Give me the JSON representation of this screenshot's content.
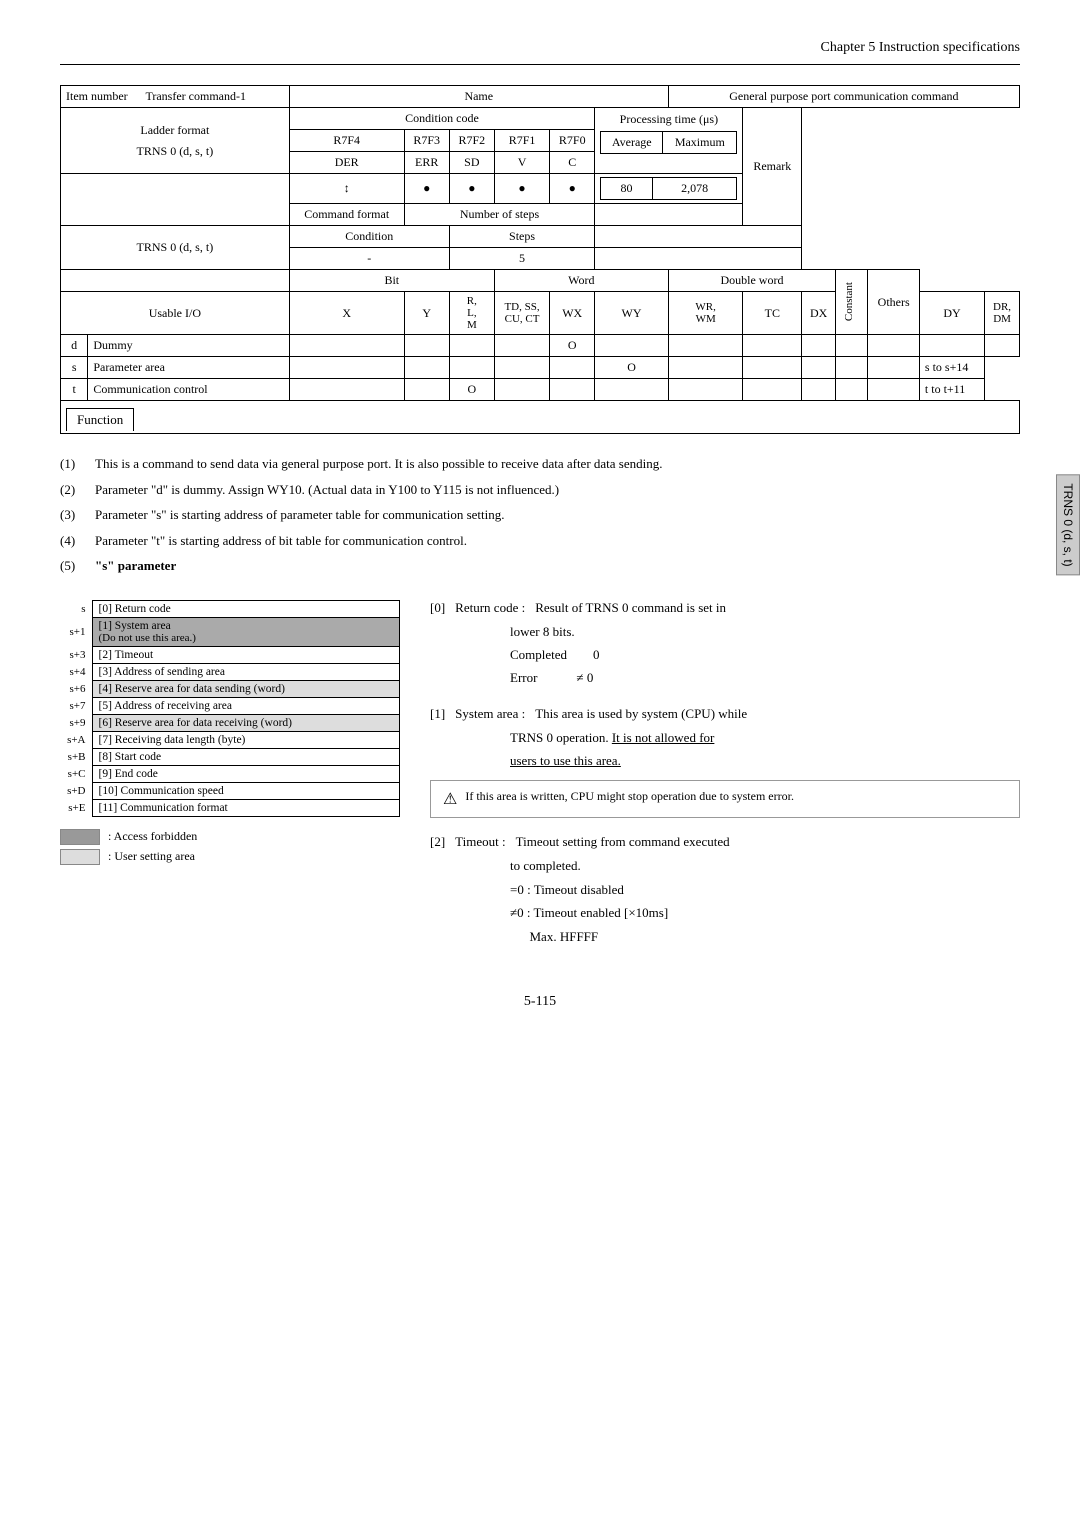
{
  "chapter": {
    "title": "Chapter 5   Instruction specifications"
  },
  "table": {
    "item_number_label": "Item number",
    "transfer_command_label": "Transfer command-1",
    "name_label": "Name",
    "name_value": "General purpose port communication command",
    "ladder_format_label": "Ladder format",
    "condition_code_label": "Condition code",
    "processing_time_label": "Processing time (μs)",
    "remark_label": "Remark",
    "r7f4": "R7F4",
    "r7f3": "R7F3",
    "r7f2": "R7F2",
    "r7f1": "R7F1",
    "r7f0": "R7F0",
    "average_label": "Average",
    "maximum_label": "Maximum",
    "der": "DER",
    "err": "ERR",
    "sd": "SD",
    "v": "V",
    "c": "C",
    "trns_label": "TRNS 0 (d, s, t)",
    "arrow_updown": "↕",
    "bullet": "●",
    "command_format_label": "Command format",
    "num_steps_label": "Number of steps",
    "avg_value": "80",
    "max_value": "2,078",
    "condition_label": "Condition",
    "steps_label": "Steps",
    "dash": "-",
    "five": "5",
    "bit_label": "Bit",
    "word_label": "Word",
    "double_word_label": "Double word",
    "usable_io_label": "Usable I/O",
    "x": "X",
    "y": "Y",
    "r_l_m": "R,\nL,\nM",
    "td_ss_cu_ct": "TD,  SS,\nCU, CT",
    "wx": "WX",
    "wy": "WY",
    "wr_wm": "WR,\nWM",
    "tc": "TC",
    "dx": "DX",
    "dy": "DY",
    "dr_dm": "DR,\nDM",
    "constant": "Constant",
    "others": "Others",
    "d_label": "d",
    "d_desc": "Dummy",
    "s_label": "s",
    "s_desc": "Parameter area",
    "t_label": "t",
    "t_desc": "Communication control",
    "circle": "O",
    "s_others": "s to s+14",
    "t_others": "t to t+11",
    "function_label": "Function"
  },
  "descriptions": [
    {
      "num": "(1)",
      "text": "This is a command to send data via general purpose port. It is also possible to receive data after data sending."
    },
    {
      "num": "(2)",
      "text": "Parameter \"d\" is dummy. Assign WY10. (Actual data in Y100 to Y115 is not influenced.)"
    },
    {
      "num": "(3)",
      "text": "Parameter \"s\" is starting address of parameter table for communication setting."
    },
    {
      "num": "(4)",
      "text": "Parameter \"t\" is starting address of bit table for communication control."
    },
    {
      "num": "(5)",
      "text": "\"s\" parameter"
    }
  ],
  "s_param": {
    "title": "\"s\" parameter",
    "rows": [
      {
        "addr": "s",
        "content": "[0] Return code"
      },
      {
        "addr": "s+1",
        "content": "[1] System area\n(Do not use this area.)"
      },
      {
        "addr": "s+3",
        "content": "[2] Timeout"
      },
      {
        "addr": "s+4",
        "content": "[3] Address of sending area"
      },
      {
        "addr": "s+6",
        "content": "[4] Reserve area for data sending (word)"
      },
      {
        "addr": "s+7",
        "content": "[5] Address of receiving area"
      },
      {
        "addr": "s+9",
        "content": "[6] Reserve area for data receiving (word)"
      },
      {
        "addr": "s+A",
        "content": "[7] Receiving data length (byte)"
      },
      {
        "addr": "s+B",
        "content": "[8] Start code"
      },
      {
        "addr": "s+C",
        "content": "[9] End code"
      },
      {
        "addr": "s+D",
        "content": "[10] Communication speed"
      },
      {
        "addr": "s+E",
        "content": "[11] Communication format"
      }
    ],
    "legend": [
      {
        "type": "dark",
        "label": ": Access forbidden"
      },
      {
        "type": "light",
        "label": ": User setting area"
      }
    ]
  },
  "right_info": {
    "block0": {
      "bracket": "[0]",
      "label": "Return code :",
      "lines": [
        "Result of TRNS 0 command is set in",
        "lower 8 bits.",
        "Completed        0",
        "Error            ≠ 0"
      ]
    },
    "block1": {
      "bracket": "[1]",
      "label": "System area :",
      "lines": [
        "This area is used by system (CPU) while",
        "TRNS 0 operation. It is not allowed for",
        "users to use this area."
      ],
      "underline_line": 2
    },
    "warning": "If this area is written, CPU might stop operation due to system error.",
    "block2": {
      "bracket": "[2]",
      "label": "Timeout :",
      "lines": [
        "Timeout setting from command executed",
        "to completed.",
        "=0 : Timeout disabled",
        "≠0 : Timeout enabled [×10ms]",
        "      Max. HFFFF"
      ]
    }
  },
  "page_number": "5-115",
  "side_tab": "TRNS 0 (d, s, t)"
}
